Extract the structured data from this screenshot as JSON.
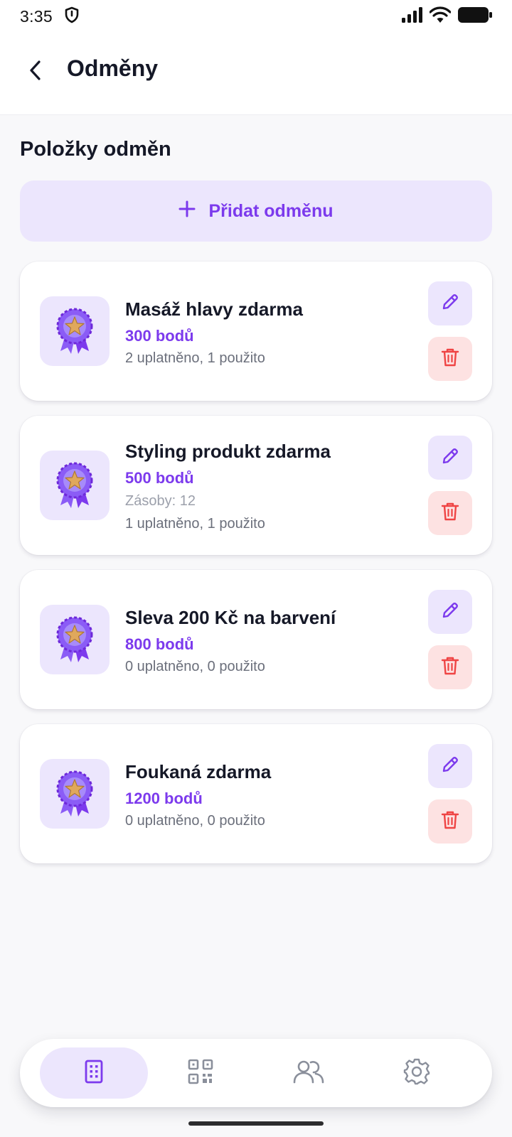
{
  "status_bar": {
    "time": "3:35",
    "icons": [
      "shield-icon",
      "signal-icon",
      "wifi-icon",
      "battery-icon"
    ]
  },
  "header": {
    "back_icon": "chevron-left-icon",
    "title": "Odměny"
  },
  "section": {
    "title": "Položky odměn"
  },
  "add_button": {
    "icon": "plus-icon",
    "label": "Přidat odměnu"
  },
  "rewards": [
    {
      "name": "Masáž hlavy zdarma",
      "points": "300 bodů",
      "stock": "",
      "usage": "2 uplatněno, 1 použito"
    },
    {
      "name": "Styling produkt zdarma",
      "points": "500 bodů",
      "stock": "Zásoby: 12",
      "usage": "1 uplatněno, 1 použito"
    },
    {
      "name": "Sleva 200 Kč na barvení",
      "points": "800 bodů",
      "stock": "",
      "usage": "0 uplatněno, 0 použito"
    },
    {
      "name": "Foukaná zdarma",
      "points": "1200 bodů",
      "stock": "",
      "usage": "0 uplatněno, 0 použito"
    }
  ],
  "bottom_nav": {
    "items": [
      {
        "icon": "building-icon",
        "active": true
      },
      {
        "icon": "qr-code-icon",
        "active": false
      },
      {
        "icon": "users-icon",
        "active": false
      },
      {
        "icon": "gear-icon",
        "active": false
      }
    ]
  },
  "colors": {
    "accent": "#7c3aed",
    "accent_light": "#ece6fd",
    "danger": "#ef4444",
    "danger_light": "#fde2e2",
    "background": "#f8f8fa"
  }
}
